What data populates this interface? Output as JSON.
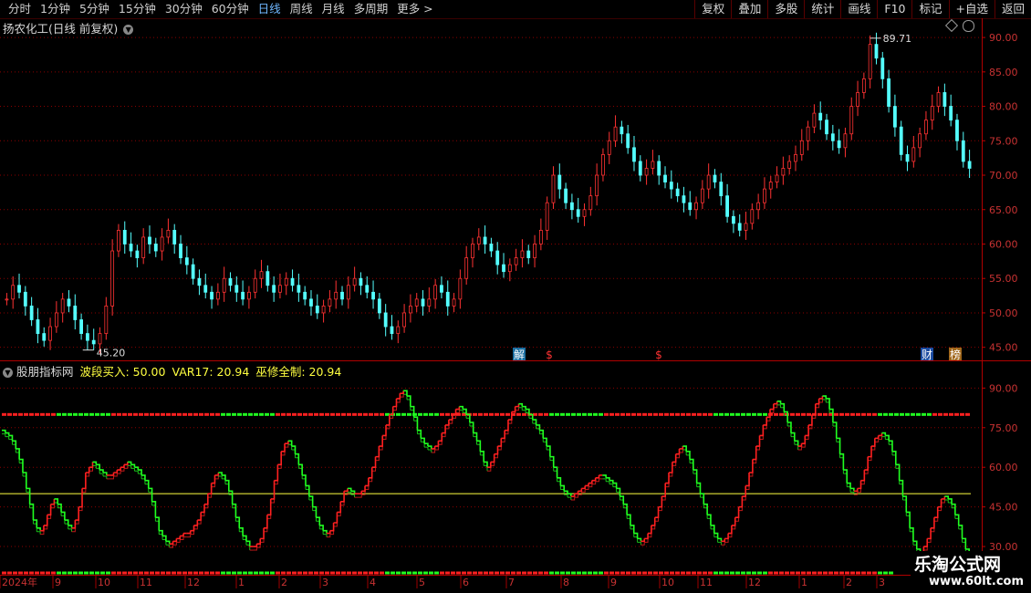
{
  "toolbar": {
    "periods": [
      "分时",
      "1分钟",
      "5分钟",
      "15分钟",
      "30分钟",
      "60分钟",
      "日线",
      "周线",
      "月线",
      "多周期",
      "更多 >"
    ],
    "active_period": "日线",
    "buttons": [
      "复权",
      "叠加",
      "多股",
      "统计",
      "画线",
      "F10",
      "标记",
      "+自选",
      "返回"
    ]
  },
  "main_panel": {
    "title": "扬农化工(日线 前复权)",
    "y_ticks": [
      "90.00",
      "85.00",
      "80.00",
      "75.00",
      "70.00",
      "65.00",
      "60.00",
      "55.00",
      "50.00",
      "45.00"
    ],
    "high_label": "89.71",
    "low_label": "45.20",
    "event_markers": [
      "解",
      "$",
      "$",
      "财",
      "榜"
    ]
  },
  "indicator_panel": {
    "name": "股朋指标网",
    "label1": "波段买入: 50.00",
    "label2": "VAR17: 20.94",
    "label3": "巫修全制: 20.94",
    "y_ticks": [
      "90.00",
      "75.00",
      "60.00",
      "45.00",
      "30.00"
    ]
  },
  "x_axis": {
    "labels": [
      "2024年",
      "9",
      "10",
      "11",
      "12",
      "1",
      "2",
      "3",
      "4",
      "5",
      "6",
      "7",
      "8",
      "9",
      "10",
      "11",
      "12",
      "1",
      "2",
      "3"
    ]
  },
  "watermark": {
    "title": "乐淘公式网",
    "url": "www.60lt.com"
  },
  "colors": {
    "up": "#ff3232",
    "down": "#54ffff",
    "ind_up": "#ff2020",
    "ind_down": "#20ff20",
    "mid_line": "#ffff40",
    "grid": "#8a0000"
  },
  "chart_data": {
    "type": "candlestick",
    "close_series": [
      52,
      54,
      53,
      51,
      49,
      47,
      46,
      48,
      50,
      52,
      51,
      49,
      47,
      46,
      45.5,
      47,
      51,
      59,
      62,
      60,
      59,
      58,
      61,
      60,
      59,
      61,
      62,
      60,
      58,
      57,
      55,
      54,
      53,
      52,
      53,
      55,
      54,
      53,
      52,
      53,
      55,
      56,
      54,
      53,
      54,
      55,
      54,
      53,
      52,
      51,
      50,
      51,
      52,
      53,
      52,
      54,
      55,
      54,
      53,
      52,
      50,
      48,
      47,
      48,
      50,
      51,
      52,
      51,
      52,
      54,
      53,
      51,
      52,
      55,
      58,
      60,
      61,
      60,
      59,
      57,
      56,
      57,
      58,
      59,
      58,
      60,
      62,
      66,
      70,
      68,
      66,
      65,
      64,
      65,
      67,
      70,
      73,
      75,
      77,
      76,
      74,
      72,
      70,
      71,
      72,
      70,
      69,
      68,
      67,
      66,
      65,
      66,
      68,
      70,
      69,
      67,
      64,
      63,
      62,
      63,
      65,
      66,
      68,
      69,
      70,
      71,
      72,
      73,
      75,
      77,
      79,
      78,
      76,
      75,
      74,
      76,
      80,
      82,
      84,
      89,
      87,
      84,
      80,
      77,
      73,
      72,
      74,
      76,
      78,
      80,
      82,
      80,
      78,
      75,
      72,
      71
    ],
    "y_range": [
      43.5,
      92
    ],
    "indicator_series": [
      74,
      73,
      72,
      70,
      67,
      63,
      58,
      52,
      46,
      40,
      37,
      36,
      38,
      42,
      46,
      48,
      46,
      43,
      40,
      38,
      37,
      40,
      45,
      52,
      58,
      60,
      62,
      61,
      59,
      58,
      57,
      57,
      58,
      59,
      60,
      61,
      62,
      61,
      60,
      59,
      57,
      55,
      52,
      47,
      41,
      36,
      34,
      32,
      31,
      32,
      33,
      34,
      35,
      35,
      36,
      38,
      40,
      43,
      46,
      50,
      54,
      57,
      58,
      57,
      55,
      51,
      46,
      41,
      37,
      34,
      32,
      30,
      30,
      31,
      33,
      37,
      42,
      48,
      55,
      61,
      66,
      69,
      70,
      68,
      65,
      61,
      57,
      53,
      49,
      45,
      41,
      38,
      36,
      35,
      36,
      39,
      43,
      47,
      51,
      52,
      51,
      50,
      50,
      51,
      53,
      56,
      60,
      64,
      68,
      72,
      76,
      80,
      83,
      86,
      88,
      89,
      87,
      83,
      79,
      74,
      71,
      69,
      68,
      67,
      68,
      70,
      73,
      76,
      78,
      80,
      82,
      83,
      82,
      80,
      77,
      73,
      70,
      66,
      62,
      60,
      62,
      65,
      68,
      71,
      74,
      78,
      81,
      83,
      84,
      83,
      82,
      80,
      78,
      76,
      74,
      71,
      68,
      64,
      60,
      56,
      53,
      51,
      50,
      49,
      50,
      51,
      52,
      53,
      54,
      55,
      56,
      57,
      57,
      56,
      55,
      54,
      52,
      49,
      46,
      42,
      38,
      35,
      33,
      32,
      33,
      35,
      38,
      41,
      45,
      49,
      54,
      58,
      62,
      65,
      67,
      68,
      66,
      63,
      59,
      54,
      50,
      46,
      42,
      38,
      35,
      33,
      32,
      33,
      35,
      38,
      41,
      45,
      49,
      53,
      58,
      63,
      68,
      72,
      76,
      79,
      82,
      84,
      85,
      84,
      81,
      77,
      73,
      70,
      68,
      69,
      72,
      76,
      80,
      84,
      86,
      87,
      86,
      82,
      77,
      71,
      65,
      59,
      54,
      52,
      51,
      52,
      55,
      59,
      64,
      68,
      71,
      72,
      73,
      72,
      70,
      66,
      61,
      55,
      49,
      43,
      37,
      32,
      29,
      28,
      30,
      33,
      37,
      41,
      45,
      48,
      49,
      48,
      46,
      42,
      38,
      33,
      29,
      26
    ],
    "indicator_y_range": [
      20,
      96
    ],
    "levels": {
      "high_band": 80,
      "mid": 50,
      "low_band": 20
    }
  }
}
